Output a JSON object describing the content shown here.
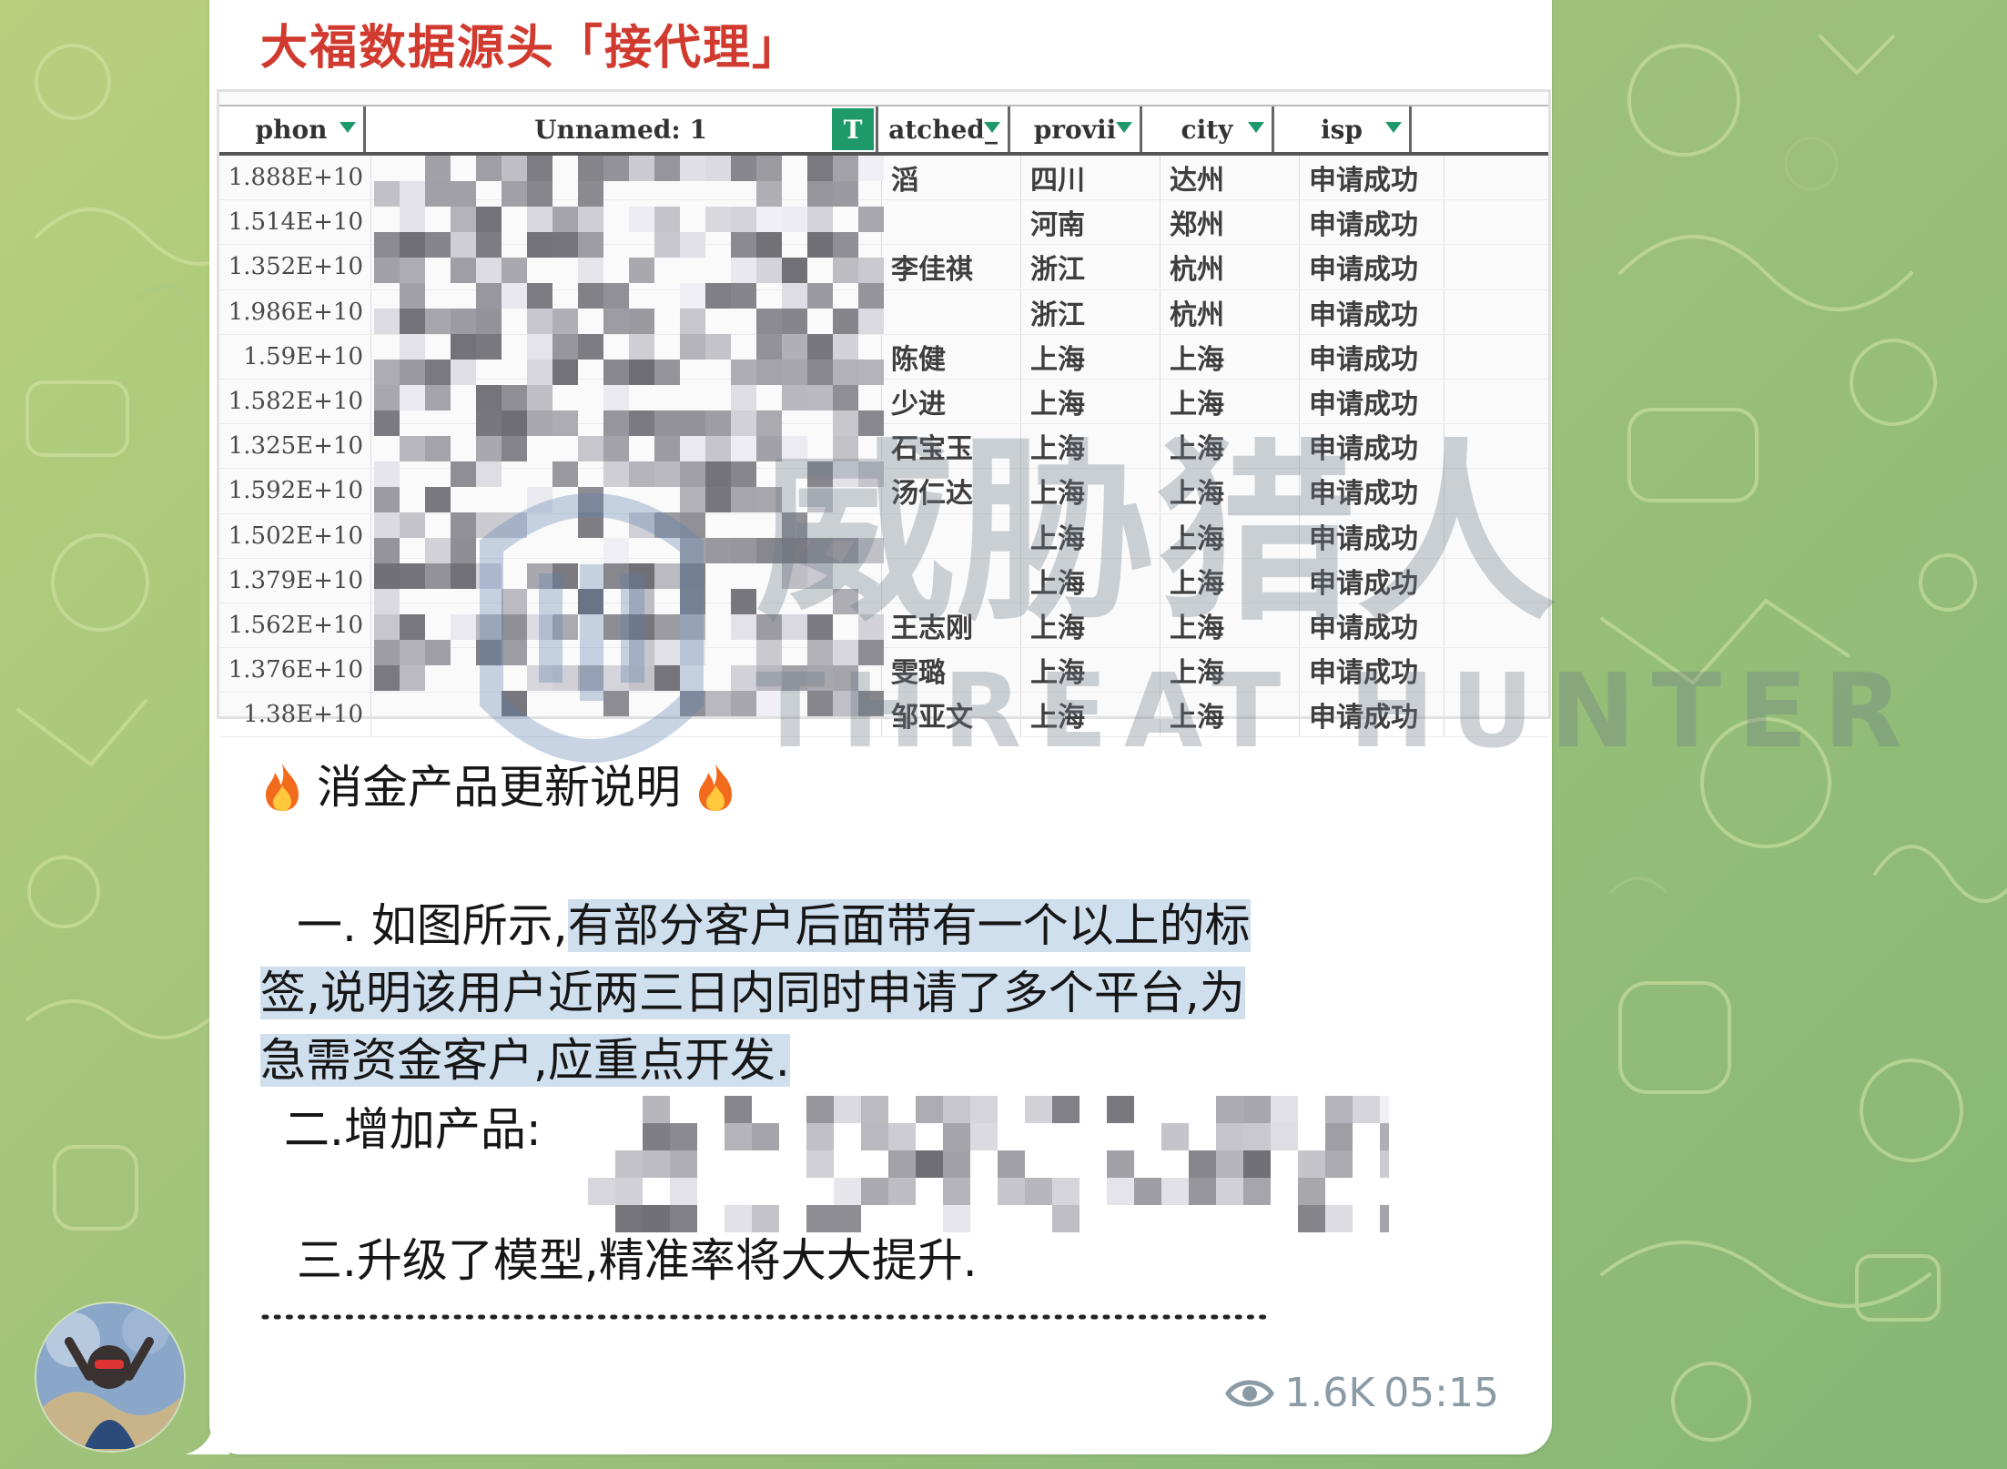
{
  "post": {
    "channel_name": "大福数据源头「接代理」",
    "views": "1.6K",
    "time": "05:15",
    "dots": "........................................................................................................"
  },
  "sheet": {
    "columns": [
      {
        "label": "phon",
        "filter_icon": "dropdown-arrow"
      },
      {
        "label": "Unnamed: 1",
        "filter_icon": "filter-active"
      },
      {
        "label": "atched_",
        "filter_icon": "dropdown-arrow"
      },
      {
        "label": "provii",
        "filter_icon": "dropdown-arrow"
      },
      {
        "label": "city",
        "filter_icon": "dropdown-arrow"
      },
      {
        "label": "isp",
        "filter_icon": "dropdown-arrow"
      }
    ],
    "filter_button_label": "T",
    "rows": [
      {
        "phone": "1.888E+10",
        "matched": "滔",
        "province": "四川",
        "city": "达州",
        "isp": "申请成功"
      },
      {
        "phone": "1.514E+10",
        "matched": "",
        "province": "河南",
        "city": "郑州",
        "isp": "申请成功"
      },
      {
        "phone": "1.352E+10",
        "matched": "李佳祺",
        "province": "浙江",
        "city": "杭州",
        "isp": "申请成功"
      },
      {
        "phone": "1.986E+10",
        "matched": "",
        "province": "浙江",
        "city": "杭州",
        "isp": "申请成功"
      },
      {
        "phone": "1.59E+10",
        "matched": "陈健",
        "province": "上海",
        "city": "上海",
        "isp": "申请成功"
      },
      {
        "phone": "1.582E+10",
        "matched": "少进",
        "province": "上海",
        "city": "上海",
        "isp": "申请成功"
      },
      {
        "phone": "1.325E+10",
        "matched": "石宝玉",
        "province": "上海",
        "city": "上海",
        "isp": "申请成功"
      },
      {
        "phone": "1.592E+10",
        "matched": "汤仁达",
        "province": "上海",
        "city": "上海",
        "isp": "申请成功"
      },
      {
        "phone": "1.502E+10",
        "matched": "",
        "province": "上海",
        "city": "上海",
        "isp": "申请成功"
      },
      {
        "phone": "1.379E+10",
        "matched": "",
        "province": "上海",
        "city": "上海",
        "isp": "申请成功"
      },
      {
        "phone": "1.562E+10",
        "matched": "王志刚",
        "province": "上海",
        "city": "上海",
        "isp": "申请成功"
      },
      {
        "phone": "1.376E+10",
        "matched": "雯璐",
        "province": "上海",
        "city": "上海",
        "isp": "申请成功"
      },
      {
        "phone": "1.38E+10",
        "matched": "邹亚文",
        "province": "上海",
        "city": "上海",
        "isp": "申请成功"
      }
    ]
  },
  "text": {
    "title": "消金产品更新说明",
    "p1_lead": "一. 如图所示,",
    "p1_highlight_a": "有部分客户后面带有一个以上的标",
    "p1_highlight_b": "签,说明该用户近两三日内同时申请了多个平台,为",
    "p1_highlight_c": "急需资金客户,应重点开发.",
    "p2_lead": "二.增加产品:",
    "p3": "三.升级了模型,精准率将大大提升."
  },
  "watermark": {
    "cn": "威胁猎人",
    "en": "THREAT HUNTER"
  },
  "colors": {
    "channel_name": "#d13a2f",
    "highlight": "#cfdfee",
    "meta": "#8a9ba6",
    "filter_green": "#1e9a6a"
  },
  "icons": {
    "views": "eye-icon",
    "title_decoration": "fire-icon"
  }
}
